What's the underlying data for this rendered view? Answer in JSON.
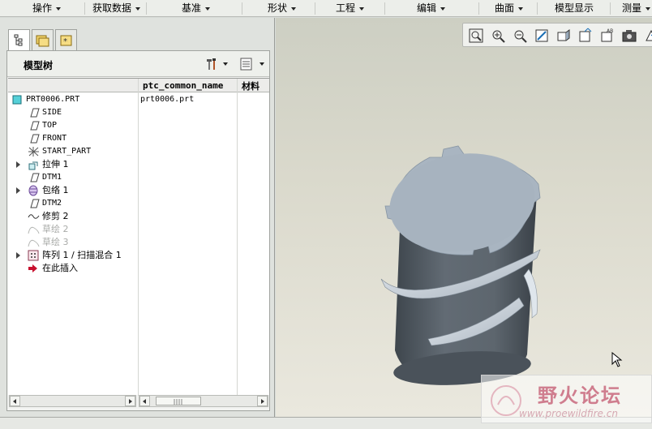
{
  "menu": {
    "items": [
      "操作",
      "获取数据",
      "基准",
      "形状",
      "工程",
      "编辑",
      "曲面",
      "模型显示",
      "测量"
    ]
  },
  "tree": {
    "title": "模型树",
    "columns": {
      "name_col": "ptc_common_name",
      "material_col": "材料"
    },
    "rows": [
      {
        "label": "PRT0006.PRT",
        "common_name": "prt0006.prt",
        "icon": "part-icon"
      },
      {
        "label": "SIDE",
        "icon": "datum-plane-icon"
      },
      {
        "label": "TOP",
        "icon": "datum-plane-icon"
      },
      {
        "label": "FRONT",
        "icon": "datum-plane-icon"
      },
      {
        "label": "START_PART",
        "icon": "coordinate-system-icon"
      },
      {
        "label": "拉伸 1",
        "icon": "extrude-icon"
      },
      {
        "label": "DTM1",
        "icon": "datum-plane-icon"
      },
      {
        "label": "包络 1",
        "icon": "wrap-icon"
      },
      {
        "label": "DTM2",
        "icon": "datum-plane-icon"
      },
      {
        "label": "修剪 2",
        "icon": "trim-icon"
      },
      {
        "label": "草绘 2",
        "icon": "sketch-icon"
      },
      {
        "label": "草绘 3",
        "icon": "sketch-icon"
      },
      {
        "label": "阵列 1 / 扫描混合 1",
        "icon": "pattern-icon"
      },
      {
        "label": "在此插入",
        "icon": "insert-here-arrow-icon"
      }
    ]
  },
  "toolbar_icons": [
    "zoom-fit-icon",
    "zoom-in-icon",
    "zoom-out-icon",
    "repaint-icon",
    "display-style-icon",
    "view-manager-icon",
    "datum-display-icon",
    "saved-views-icon",
    "spin-center-icon",
    "annotation-icon"
  ],
  "watermark": {
    "title": "野火论坛",
    "url": "www.proewildfire.cn"
  },
  "colors": {
    "model_body": "#5a636b",
    "model_top": "#aab6c2",
    "background_top": "#cdcfc3",
    "background_bottom": "#eae8de"
  }
}
